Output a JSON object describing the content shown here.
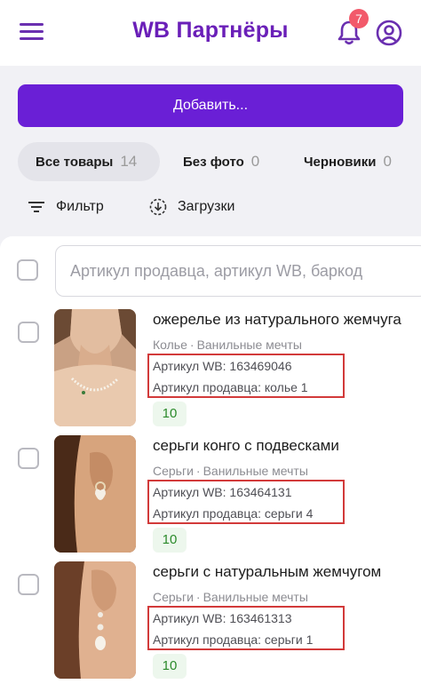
{
  "header": {
    "title": "WB Партнёры",
    "notifications_count": "7",
    "brand_color": "#6a1fb8"
  },
  "actions": {
    "add_label": "Добавить..."
  },
  "tabs": [
    {
      "label": "Все товары",
      "count": "14",
      "active": true
    },
    {
      "label": "Без фото",
      "count": "0",
      "active": false
    },
    {
      "label": "Черновики",
      "count": "0",
      "active": false
    }
  ],
  "toolbar": {
    "filter_label": "Фильтр",
    "downloads_label": "Загрузки"
  },
  "search": {
    "placeholder": "Артикул продавца, артикул WB, баркод",
    "value": ""
  },
  "products": [
    {
      "title": "ожерелье из натурального жемчуга",
      "category": "Колье",
      "brand": "Ванильные мечты",
      "wb_article": "Артикул WB: 163469046",
      "seller_article": "Артикул продавца: колье 1",
      "stock": "10"
    },
    {
      "title": "серьги конго с подвесками",
      "category": "Серьги",
      "brand": "Ванильные мечты",
      "wb_article": "Артикул WB: 163464131",
      "seller_article": "Артикул продавца: серьги 4",
      "stock": "10"
    },
    {
      "title": "серьги с натуральным жемчугом",
      "category": "Серьги",
      "brand": "Ванильные мечты",
      "wb_article": "Артикул WB: 163461313",
      "seller_article": "Артикул продавца: серьги 1",
      "stock": "10"
    }
  ],
  "colors": {
    "accent": "#6a1fd6",
    "highlight_box": "#d23a3a",
    "stock_text": "#2b8a2b"
  }
}
